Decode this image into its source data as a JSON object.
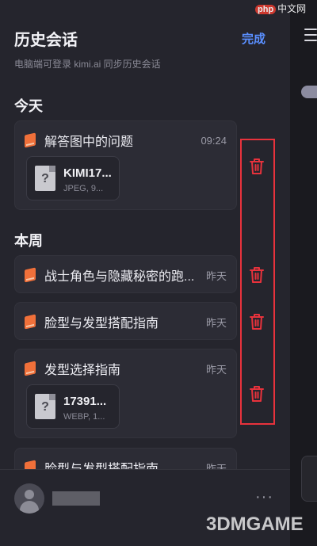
{
  "header": {
    "title": "历史会话",
    "done_label": "完成",
    "subtitle": "电脑端可登录 kimi.ai 同步历史会话"
  },
  "sections": {
    "today": "今天",
    "this_week": "本周"
  },
  "conversations": [
    {
      "title": "解答图中的问题",
      "time": "09:24",
      "file": {
        "name": "KIMI17...",
        "meta": "JPEG, 9..."
      }
    },
    {
      "title": "战士角色与隐藏秘密的跑...",
      "time": "昨天"
    },
    {
      "title": "脸型与发型搭配指南",
      "time": "昨天"
    },
    {
      "title": "发型选择指南",
      "time": "昨天",
      "file": {
        "name": "17391...",
        "meta": "WEBP, 1..."
      }
    },
    {
      "title": "脸型与发型搭配指南",
      "time": "昨天"
    }
  ],
  "footer": {
    "more": "···"
  },
  "watermarks": {
    "bottom": "3DMGAME",
    "top_badge": "php",
    "top_text": "中文网"
  },
  "colors": {
    "accent": "#5a8fff",
    "delete": "#e8323c",
    "book_icon": "#f0703a"
  }
}
